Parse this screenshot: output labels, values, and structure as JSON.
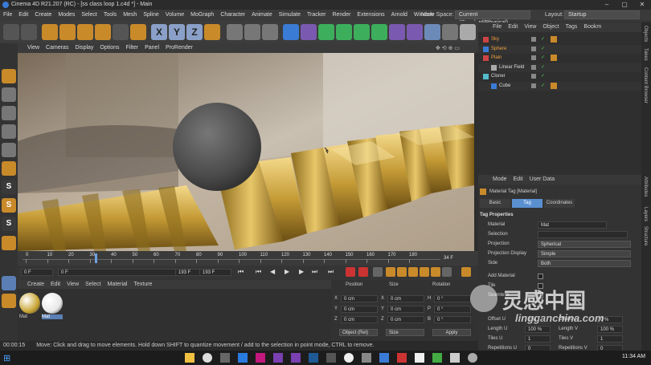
{
  "window": {
    "title": "Cinema 4D R21.207 (RC) - [ss class loop 1.c4d *] - Main"
  },
  "menu": {
    "items": [
      "File",
      "Edit",
      "Create",
      "Modes",
      "Select",
      "Tools",
      "Mesh",
      "Spline",
      "Volume",
      "MoGraph",
      "Character",
      "Animate",
      "Simulate",
      "Tracker",
      "Render",
      "Extensions",
      "Arnold",
      "Window"
    ],
    "node_space_label": "Node Space:",
    "node_space_value": "Current (Standard/Physical)",
    "layout_label": "Layout:",
    "layout_value": "Startup"
  },
  "viewport": {
    "menu": [
      "View",
      "Cameras",
      "Display",
      "Options",
      "Filter",
      "Panel",
      "ProRender"
    ]
  },
  "timeline": {
    "ticks": [
      "0",
      "10",
      "20",
      "30",
      "40",
      "50",
      "60",
      "70",
      "80",
      "90",
      "100",
      "110",
      "120",
      "130",
      "140",
      "150",
      "160",
      "170",
      "180"
    ],
    "current_marker": "34 F",
    "end_marker": "34 F"
  },
  "transport": {
    "start_field": "0 F",
    "frame_field": "0 F",
    "end_field": "193 F",
    "max_field": "193 F"
  },
  "materials": {
    "menu": [
      "Create",
      "Edit",
      "View",
      "Select",
      "Material",
      "Texture"
    ],
    "items": [
      {
        "label": "Mat",
        "color": "#c9a534"
      },
      {
        "label": "Mat",
        "color": "#e8e8e8"
      }
    ]
  },
  "coordinates": {
    "headers": [
      "Position",
      "Size",
      "Rotation"
    ],
    "rows": [
      {
        "axis": "X",
        "pos": "0 cm",
        "saxis": "X",
        "size": "0 cm",
        "raxis": "H",
        "rot": "0 °"
      },
      {
        "axis": "Y",
        "pos": "0 cm",
        "saxis": "Y",
        "size": "0 cm",
        "raxis": "P",
        "rot": "0 °"
      },
      {
        "axis": "Z",
        "pos": "0 cm",
        "saxis": "Z",
        "size": "0 cm",
        "raxis": "B",
        "rot": "0 °"
      }
    ],
    "mode_select": "Object (Rel)",
    "size_select": "Size",
    "apply": "Apply"
  },
  "status": {
    "time": "00:00:15",
    "text": "Move: Click and drag to move elements. Hold down SHIFT to quantize movement / add to the selection in point mode, CTRL to remove."
  },
  "objects": {
    "menu": [
      "File",
      "Edit",
      "View",
      "Object",
      "Tags",
      "Bookm"
    ],
    "rows": [
      {
        "name": "Sky",
        "indent": 0,
        "icon_color": "#c44"
      },
      {
        "name": "Sphere",
        "indent": 0,
        "icon_color": "#3a7bd5"
      },
      {
        "name": "Plain",
        "indent": 0,
        "icon_color": "#c44"
      },
      {
        "name": "Linear Field",
        "indent": 1,
        "icon_color": "#aaa"
      },
      {
        "name": "Cloner",
        "indent": 0,
        "icon_color": "#5bc"
      },
      {
        "name": "Cube",
        "indent": 1,
        "icon_color": "#3a7bd5"
      }
    ]
  },
  "attributes": {
    "menu": [
      "Mode",
      "Edit",
      "User Data"
    ],
    "header": "Material Tag [Material]",
    "tabs": [
      "Basic",
      "Tag",
      "Coordinates"
    ],
    "active_tab": "Tag",
    "section": "Tag Properties",
    "fields": [
      {
        "label": "Material",
        "value": "Mat"
      },
      {
        "label": "Selection",
        "value": ""
      },
      {
        "label": "Projection",
        "value": "Spherical"
      },
      {
        "label": "Projection Display",
        "value": "Simple"
      },
      {
        "label": "Side",
        "value": "Both"
      }
    ],
    "checks": [
      "Add Material",
      "Tile",
      "Seamless"
    ],
    "offset_row": {
      "l1": "Offset U",
      "v1": "0 %",
      "l2": "Offset V",
      "v2": "0 %"
    },
    "length_row": {
      "l1": "Length U",
      "v1": "100 %",
      "l2": "Length V",
      "v2": "100 %"
    },
    "tiles_row": {
      "l1": "Tiles U",
      "v1": "1",
      "l2": "Tiles V",
      "v2": "1"
    },
    "repetitions_row": {
      "l1": "Repetitions U",
      "v1": "0",
      "l2": "Repetitions V",
      "v2": "0"
    }
  },
  "right_tabs": [
    "Objects",
    "Takes",
    "Content Browser",
    "Attributes",
    "Layers",
    "Structure"
  ],
  "taskbar": {
    "time": "11:34 AM"
  },
  "watermark": {
    "cn": "灵感中国",
    "url": "lingganchina.com"
  }
}
